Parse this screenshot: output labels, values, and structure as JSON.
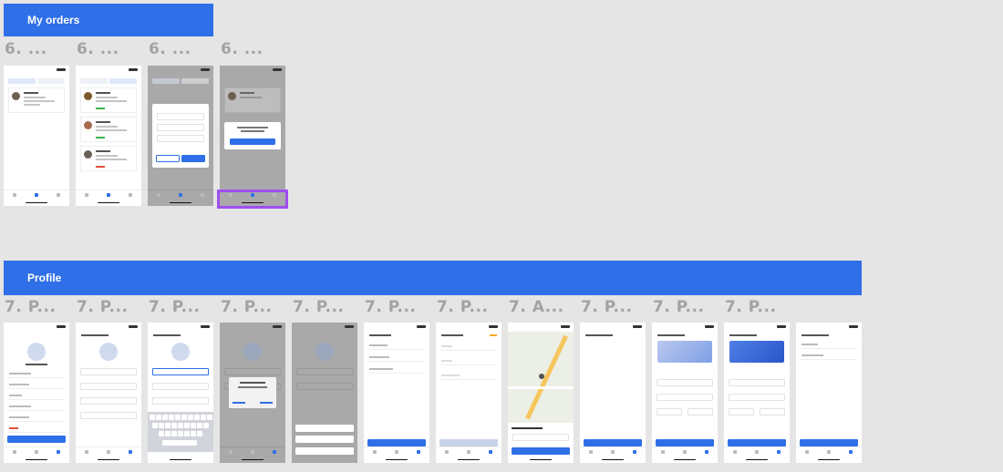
{
  "sections": {
    "orders": {
      "title": "My orders"
    },
    "profile": {
      "title": "Profile"
    }
  },
  "orders_frames": [
    {
      "label": "6. ..."
    },
    {
      "label": "6. ..."
    },
    {
      "label": "6. ..."
    },
    {
      "label": "6. ..."
    }
  ],
  "profile_frames": [
    {
      "label": "7. P..."
    },
    {
      "label": "7. P..."
    },
    {
      "label": "7. P..."
    },
    {
      "label": "7. P..."
    },
    {
      "label": "7. P..."
    },
    {
      "label": "7. P..."
    },
    {
      "label": "7. P..."
    },
    {
      "label": "7. A..."
    },
    {
      "label": "7. P..."
    },
    {
      "label": "7. P..."
    },
    {
      "label": "7. P..."
    }
  ],
  "colors": {
    "accent": "#2f6fe8",
    "canvas": "#e5e5e5",
    "label": "#a3a3a3",
    "selection": "#a04ef0"
  }
}
